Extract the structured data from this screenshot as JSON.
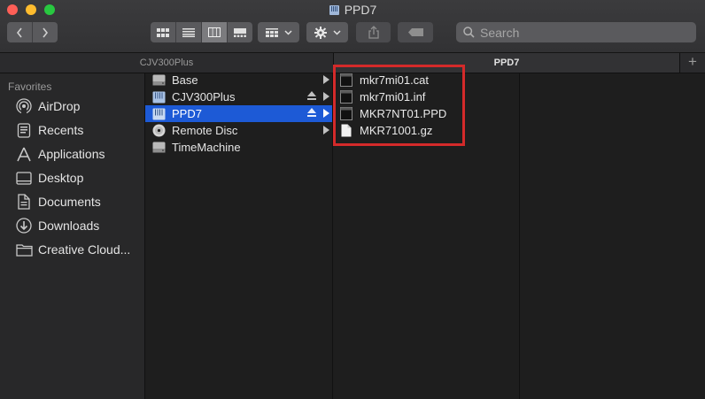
{
  "window": {
    "title": "PPD7"
  },
  "toolbar": {
    "search_placeholder": "Search"
  },
  "pathbar": {
    "column1": "CJV300Plus",
    "column2": "PPD7",
    "add_symbol": "+"
  },
  "sidebar": {
    "heading": "Favorites",
    "items": [
      {
        "label": "AirDrop",
        "icon": "airdrop-icon"
      },
      {
        "label": "Recents",
        "icon": "recents-icon"
      },
      {
        "label": "Applications",
        "icon": "applications-icon"
      },
      {
        "label": "Desktop",
        "icon": "desktop-icon"
      },
      {
        "label": "Documents",
        "icon": "documents-icon"
      },
      {
        "label": "Downloads",
        "icon": "downloads-icon"
      },
      {
        "label": "Creative Cloud...",
        "icon": "folder-icon"
      }
    ]
  },
  "column1": {
    "items": [
      {
        "label": "Base"
      },
      {
        "label": "CJV300Plus"
      },
      {
        "label": "PPD7"
      },
      {
        "label": "Remote Disc"
      },
      {
        "label": "TimeMachine"
      }
    ]
  },
  "column2": {
    "files": [
      {
        "label": "mkr7mi01.cat"
      },
      {
        "label": "mkr7mi01.inf"
      },
      {
        "label": "MKR7NT01.PPD"
      },
      {
        "label": "MKR71001.gz"
      }
    ]
  },
  "colors": {
    "selection": "#1d5ad6",
    "highlight_border": "#d42a2a"
  }
}
